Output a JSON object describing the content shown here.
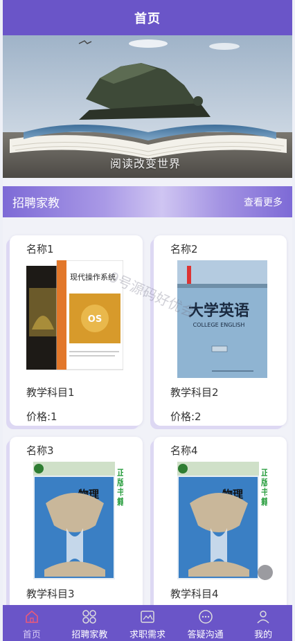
{
  "header": {
    "title": "首页"
  },
  "banner": {
    "caption": "阅读改变世界"
  },
  "section": {
    "title": "招聘家教",
    "more": "查看更多"
  },
  "cards": [
    {
      "name": "名称1",
      "subject": "教学科目1",
      "price": "价格:1",
      "book_title": "现代操作系统",
      "book_cover": "os"
    },
    {
      "name": "名称2",
      "subject": "教学科目2",
      "price": "价格:2",
      "book_title": "大学英语",
      "book_sub": "COLLEGE ENGLISH",
      "book_cover": "english"
    },
    {
      "name": "名称3",
      "subject": "教学科目3",
      "price": "",
      "book_title": "物理",
      "book_side": "正版书籍 绿色印刷",
      "book_cover": "physics"
    },
    {
      "name": "名称4",
      "subject": "教学科目4",
      "price": "",
      "book_title": "物理",
      "book_side": "正版书籍 绿色印刷",
      "book_cover": "physics"
    }
  ],
  "watermark": "9号源码好优会",
  "tabbar": {
    "items": [
      {
        "label": "首页",
        "icon": "home-icon",
        "active": true
      },
      {
        "label": "招聘家教",
        "icon": "grid-icon",
        "active": false
      },
      {
        "label": "求职需求",
        "icon": "image-icon",
        "active": false
      },
      {
        "label": "答疑沟通",
        "icon": "chat-icon",
        "active": false
      },
      {
        "label": "我的",
        "icon": "user-icon",
        "active": false
      }
    ]
  },
  "colors": {
    "primary": "#6a55c8",
    "active_tab": "#d9cdf6"
  }
}
